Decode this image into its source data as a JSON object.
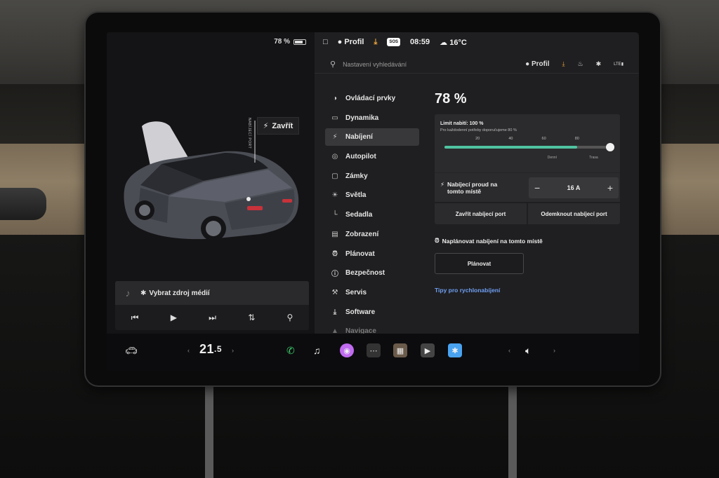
{
  "left_panel": {
    "battery_percent": "78 %",
    "battery_level": 0.78,
    "charge_port_vertical_label": "NABÍJECÍ PORT",
    "close_button_label": "Zavřít",
    "media": {
      "source_label": "Vybrat zdroj médií"
    }
  },
  "status_bar": {
    "profile_label": "Profil",
    "sos_label": "SOS",
    "time": "08:59",
    "temperature": "16°C"
  },
  "search": {
    "placeholder": "Nastavení vyhledávání"
  },
  "top_icons": {
    "profile_label": "Profil",
    "lte_label": "LTE"
  },
  "nav": {
    "items": [
      {
        "label": "Ovládací prvky",
        "icon": "toggle-icon"
      },
      {
        "label": "Dynamika",
        "icon": "car-icon"
      },
      {
        "label": "Nabíjení",
        "icon": "bolt-icon",
        "active": true
      },
      {
        "label": "Autopilot",
        "icon": "steering-wheel-icon"
      },
      {
        "label": "Zámky",
        "icon": "lock-icon"
      },
      {
        "label": "Světla",
        "icon": "sun-icon"
      },
      {
        "label": "Sedadla",
        "icon": "seat-icon"
      },
      {
        "label": "Zobrazení",
        "icon": "display-icon"
      },
      {
        "label": "Plánovat",
        "icon": "alarm-clock-icon"
      },
      {
        "label": "Bezpečnost",
        "icon": "info-circle-icon"
      },
      {
        "label": "Servis",
        "icon": "wrench-icon"
      },
      {
        "label": "Software",
        "icon": "download-icon"
      },
      {
        "label": "Navigace",
        "icon": "navigation-arrow-icon"
      }
    ]
  },
  "charging": {
    "percent": "78 %",
    "limit_title": "Limit nabití: 100 %",
    "limit_subtitle": "Pro každodenní potřeby doporučujeme 80 %",
    "limit_value": 100,
    "fill_value": 80,
    "ticks": [
      "20",
      "40",
      "60",
      "80"
    ],
    "tick_values": [
      20,
      40,
      60,
      80
    ],
    "zone_labels": [
      "Denní",
      "Trasa"
    ],
    "current_label_line1": "Nabíjecí proud na",
    "current_label_line2": "tomto místě",
    "current_value": "16 A",
    "minus_label": "−",
    "plus_label": "+",
    "close_port_label": "Zavřít nabíjecí port",
    "unlock_port_label": "Odemknout nabíjecí port",
    "schedule_title": "Naplánovat nabíjení na tomto místě",
    "schedule_button": "Plánovat",
    "tips_link": "Tipy pro rychlonabíjení",
    "accent_color": "#4fc3a0",
    "link_color": "#6f9ff2"
  },
  "dock": {
    "temperature_main": "21",
    "temperature_decimal": ".5",
    "accent_colors": {
      "phone": "#3ecf6e",
      "camera": "#c06bf0",
      "bluetooth": "#4aa3f0"
    }
  }
}
